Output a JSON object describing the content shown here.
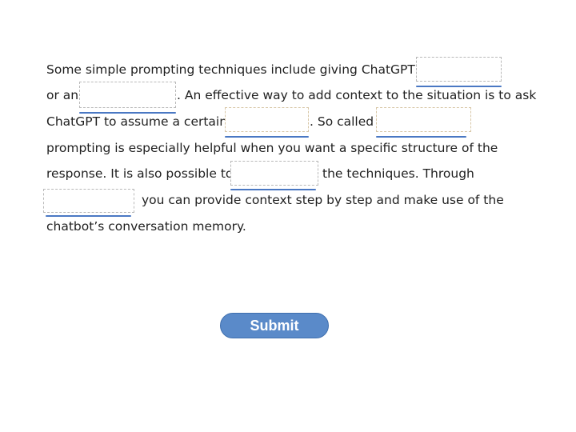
{
  "exercise": {
    "lines": [
      "Some simple prompting techniques include giving ChatGPT a",
      "or an",
      ". An effective way to add context to the situation is to ask",
      "ChatGPT to assume a certain",
      ". So called",
      "prompting is especially helpful when you want a specific structure of the",
      "response. It is also possible to",
      "the techniques. Through",
      "you can provide context step by step and make use of the",
      "chatbot’s conversation memory."
    ],
    "blanks": [
      "",
      "",
      "",
      "",
      "",
      ""
    ]
  },
  "submit_label": "Submit",
  "colors": {
    "underline": "#4a78c3",
    "button": "#5a8ac9"
  }
}
